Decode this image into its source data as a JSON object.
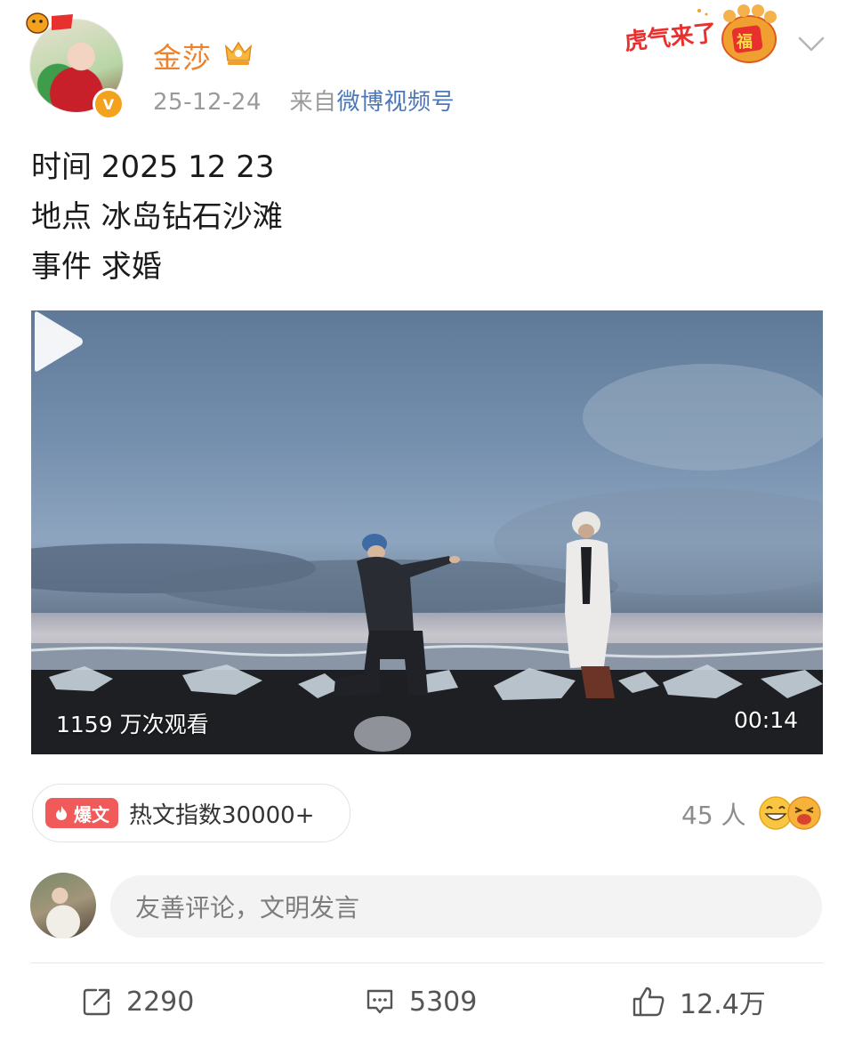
{
  "header": {
    "username": "金莎",
    "date": "25-12-24",
    "source_prefix": "来自",
    "source_name": "微博视频号",
    "badge_text": "虎气来了",
    "badge_fu": "福"
  },
  "post": {
    "lines": [
      "时间 2025 12 23",
      "地点 冰岛钻石沙滩",
      "事件 求婚"
    ]
  },
  "video": {
    "views": "1159 万次观看",
    "duration": "00:14"
  },
  "hot": {
    "tag": "爆文",
    "text": "热文指数30000+"
  },
  "reactions": {
    "count": "45 人"
  },
  "comment_box": {
    "placeholder": "友善评论，文明发言"
  },
  "actions": {
    "repost_count": "2290",
    "comment_count": "5309",
    "like_count": "12.4万"
  },
  "colors": {
    "username": "#f0812b",
    "source_link": "#4c78b8",
    "hot_tag": "#f05a5a",
    "verified": "#f4a21c"
  }
}
